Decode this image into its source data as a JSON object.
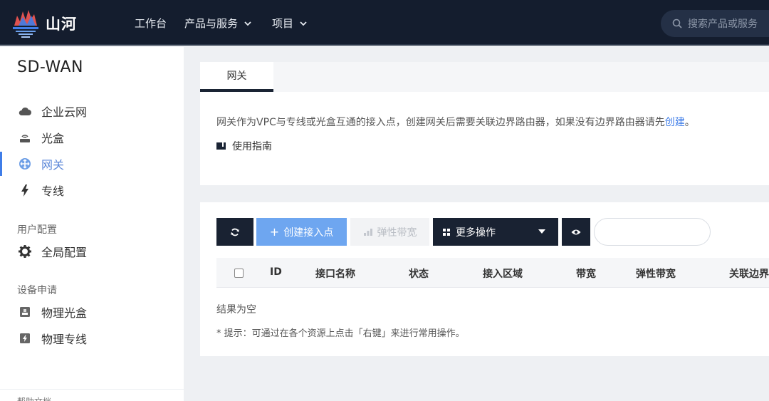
{
  "topbar": {
    "brand": "山河",
    "nav": [
      {
        "label": "工作台"
      },
      {
        "label": "产品与服务"
      },
      {
        "label": "项目"
      }
    ],
    "search_placeholder": "搜索产品或服务"
  },
  "sidebar": {
    "title": "SD-WAN",
    "items": [
      {
        "label": "企业云网",
        "icon": "cloud-icon"
      },
      {
        "label": "光盒",
        "icon": "router-icon"
      },
      {
        "label": "网关",
        "icon": "gateway-icon",
        "active": true
      },
      {
        "label": "专线",
        "icon": "lightning-icon"
      }
    ],
    "user_config_label": "用户配置",
    "user_config_items": [
      {
        "label": "全局配置",
        "icon": "gear-icon"
      }
    ],
    "device_label": "设备申请",
    "device_items": [
      {
        "label": "物理光盒",
        "icon": "device-box-icon"
      },
      {
        "label": "物理专线",
        "icon": "device-line-icon"
      }
    ],
    "bottom_text": "帮助文档"
  },
  "main": {
    "tab": "网关",
    "intro_text": "网关作为VPC与专线或光盒互通的接入点，创建网关后需要关联边界路由器，如果没有边界路由器请先",
    "intro_link": "创建",
    "intro_end": "。",
    "guide_label": "使用指南",
    "toolbar": {
      "create_label": "创建接入点",
      "elastic_label": "弹性带宽",
      "more_label": "更多操作"
    },
    "columns": [
      "ID",
      "接口名称",
      "状态",
      "接入区域",
      "带宽",
      "弹性带宽",
      "关联边界路由器"
    ],
    "empty_text": "结果为空",
    "hint_text": "* 提示：可通过在各个资源上点击「右键」来进行常用操作。"
  },
  "colors": {
    "topbar": "#141d2e",
    "accent": "#3f7de8",
    "primary_button": "#6ea6f0",
    "dark_button": "#192232"
  }
}
